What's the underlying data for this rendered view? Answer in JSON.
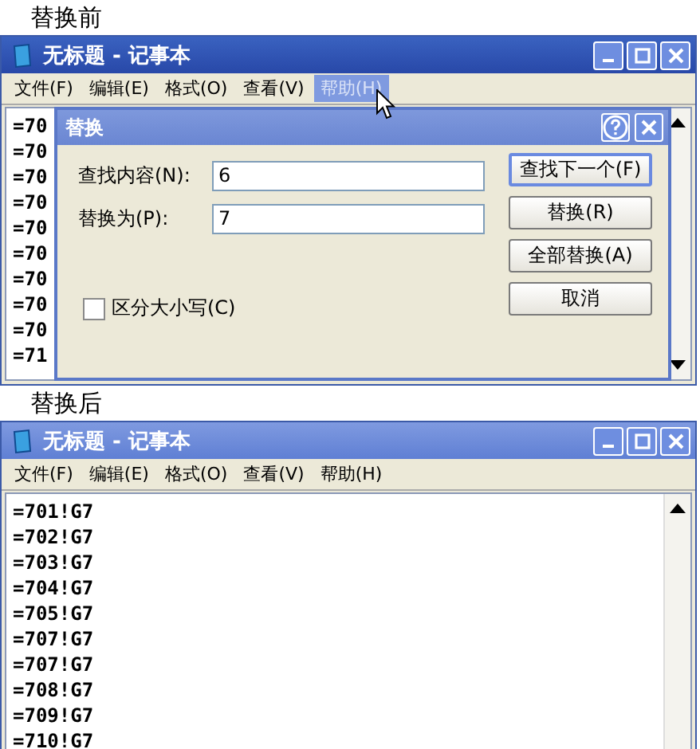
{
  "before": {
    "caption": "替换前",
    "window": {
      "title": "无标题 - 记事本",
      "active": true,
      "menu": [
        {
          "label": "文件(F)",
          "selected": false
        },
        {
          "label": "编辑(E)",
          "selected": false
        },
        {
          "label": "格式(O)",
          "selected": false
        },
        {
          "label": "查看(V)",
          "selected": false
        },
        {
          "label": "帮助(H)",
          "selected": true
        }
      ],
      "lines": [
        "=70",
        "=70",
        "=70",
        "=70",
        "=70",
        "=70",
        "=70",
        "=70",
        "=70",
        "=71"
      ]
    },
    "dialog": {
      "title": "替换",
      "fields": [
        {
          "label": "查找内容(N):",
          "value": "6"
        },
        {
          "label": "替换为(P):",
          "value": "7"
        }
      ],
      "checkbox": {
        "label": "区分大小写(C)",
        "checked": false
      },
      "buttons": [
        {
          "label": "查找下一个(F)",
          "default": true
        },
        {
          "label": "替换(R)",
          "default": false
        },
        {
          "label": "全部替换(A)",
          "default": false
        },
        {
          "label": "取消",
          "default": false
        }
      ]
    }
  },
  "after": {
    "caption": "替换后",
    "window": {
      "title": "无标题 - 记事本",
      "active": false,
      "menu": [
        {
          "label": "文件(F)",
          "selected": false
        },
        {
          "label": "编辑(E)",
          "selected": false
        },
        {
          "label": "格式(O)",
          "selected": false
        },
        {
          "label": "查看(V)",
          "selected": false
        },
        {
          "label": "帮助(H)",
          "selected": false
        }
      ],
      "lines": [
        "=701!G7",
        "=702!G7",
        "=703!G7",
        "=704!G7",
        "=705!G7",
        "=707!G7",
        "=707!G7",
        "=708!G7",
        "=709!G7",
        "=710!G7"
      ]
    }
  }
}
